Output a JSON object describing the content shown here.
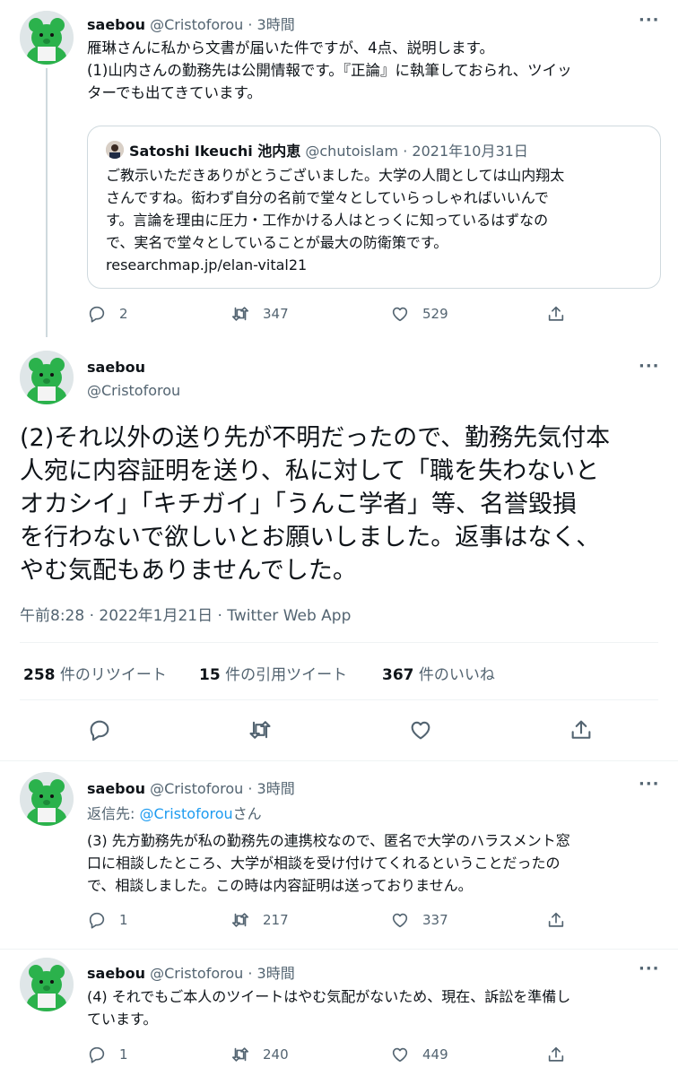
{
  "tweet1": {
    "name": "saebou",
    "handle": "@Cristoforou",
    "sep": " · ",
    "time": "3時間",
    "more": "···",
    "line1": "雁琳さんに私から文書が届いた件ですが、4点、説明します。",
    "line2": "(1)山内さんの勤務先は公開情報です。『正論』に執筆しておられ、ツイッ",
    "line3": "ターでも出てきています。",
    "quote": {
      "name": "Satoshi Ikeuchi 池内恵",
      "handle": "@chutoislam",
      "sep": " · ",
      "date": "2021年10月31日",
      "line1": "ご教示いただきありがとうございました。大学の人間としては山内翔太",
      "line2": "さんですね。衒わず自分の名前で堂々としていらっしゃればいいんで",
      "line3": "す。言論を理由に圧力・工作かける人はとっくに知っているはずなの",
      "line4": "で、実名で堂々としていることが最大の防衛策です。",
      "line5": "researchmap.jp/elan-vital21"
    },
    "replies": "2",
    "retweets": "347",
    "likes": "529"
  },
  "main": {
    "name": "saebou",
    "handle": "@Cristoforou",
    "more": "···",
    "line1": "(2)それ以外の送り先が不明だったので、勤務先気付本",
    "line2": "人宛に内容証明を送り、私に対して「職を失わないと",
    "line3": "オカシイ」「キチガイ」「うんこ学者」等、名誉毀損",
    "line4": "を行わないで欲しいとお願いしました。返事はなく、",
    "line5": "やむ気配もありませんでした。",
    "meta": "午前8:28 · 2022年1月21日 · Twitter Web App",
    "retweet_count": "258",
    "retweet_label": " 件のリツイート",
    "quote_count": "15",
    "quote_label": " 件の引用ツイート",
    "like_count": "367",
    "like_label": " 件のいいね"
  },
  "tweet3": {
    "name": "saebou",
    "handle": "@Cristoforou",
    "sep": " · ",
    "time": "3時間",
    "more": "···",
    "reply_prefix": "返信先: ",
    "reply_handle": "@Cristoforou",
    "reply_suffix": "さん",
    "line1": "(3) 先方勤務先が私の勤務先の連携校なので、匿名で大学のハラスメント窓",
    "line2": "口に相談したところ、大学が相談を受け付けてくれるということだったの",
    "line3": "で、相談しました。この時は内容証明は送っておりません。",
    "replies": "1",
    "retweets": "217",
    "likes": "337"
  },
  "tweet4": {
    "name": "saebou",
    "handle": "@Cristoforou",
    "sep": " · ",
    "time": "3時間",
    "more": "···",
    "line1": "(4) それでもご本人のツイートはやむ気配がないため、現在、訴訟を準備し",
    "line2": "ています。",
    "replies": "1",
    "retweets": "240",
    "likes": "449"
  },
  "colors": {
    "accent": "#1d9bf0",
    "text": "#0f1419",
    "secondary": "#536471",
    "avatar_green": "#2bb24c"
  },
  "icons": [
    "reply-icon",
    "retweet-icon",
    "like-icon",
    "share-icon",
    "more-icon"
  ]
}
